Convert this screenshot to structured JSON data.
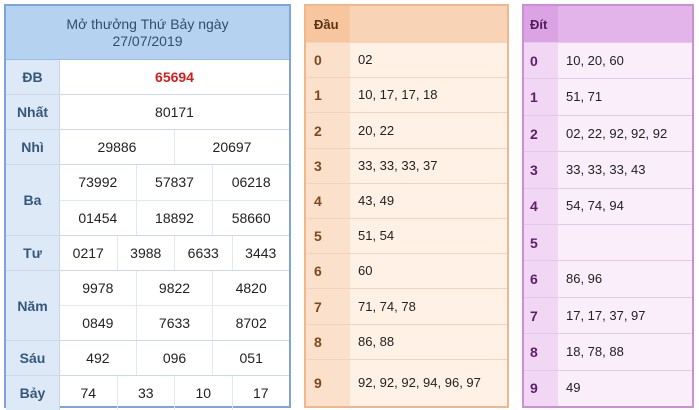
{
  "results": {
    "title_line1": "Mở thưởng Thứ Bảy ngày",
    "title_line2": "27/07/2019",
    "prizes": [
      {
        "label": "ĐB",
        "lines": [
          [
            "65694"
          ]
        ]
      },
      {
        "label": "Nhất",
        "lines": [
          [
            "80171"
          ]
        ]
      },
      {
        "label": "Nhì",
        "lines": [
          [
            "29886",
            "20697"
          ]
        ]
      },
      {
        "label": "Ba",
        "lines": [
          [
            "73992",
            "57837",
            "06218"
          ],
          [
            "01454",
            "18892",
            "58660"
          ]
        ]
      },
      {
        "label": "Tư",
        "lines": [
          [
            "0217",
            "3988",
            "6633",
            "3443"
          ]
        ]
      },
      {
        "label": "Năm",
        "lines": [
          [
            "9978",
            "9822",
            "4820"
          ],
          [
            "0849",
            "7633",
            "8702"
          ]
        ]
      },
      {
        "label": "Sáu",
        "lines": [
          [
            "492",
            "096",
            "051"
          ]
        ]
      },
      {
        "label": "Bảy",
        "lines": [
          [
            "74",
            "33",
            "10",
            "17"
          ]
        ]
      }
    ]
  },
  "dau": {
    "header": "Đầu",
    "rows": [
      {
        "k": "0",
        "v": "02"
      },
      {
        "k": "1",
        "v": "10, 17, 17, 18"
      },
      {
        "k": "2",
        "v": "20, 22"
      },
      {
        "k": "3",
        "v": "33, 33, 33, 37"
      },
      {
        "k": "4",
        "v": "43, 49"
      },
      {
        "k": "5",
        "v": "51, 54"
      },
      {
        "k": "6",
        "v": "60"
      },
      {
        "k": "7",
        "v": "71, 74, 78"
      },
      {
        "k": "8",
        "v": "86, 88"
      },
      {
        "k": "9",
        "v": "92, 92, 92, 94, 96, 97"
      }
    ]
  },
  "dit": {
    "header": "Đít",
    "rows": [
      {
        "k": "0",
        "v": "10, 20, 60"
      },
      {
        "k": "1",
        "v": "51, 71"
      },
      {
        "k": "2",
        "v": "02, 22, 92, 92, 92"
      },
      {
        "k": "3",
        "v": "33, 33, 33, 43"
      },
      {
        "k": "4",
        "v": "54, 74, 94"
      },
      {
        "k": "5",
        "v": ""
      },
      {
        "k": "6",
        "v": "86, 96"
      },
      {
        "k": "7",
        "v": "17, 17, 37, 97"
      },
      {
        "k": "8",
        "v": "18, 78, 88"
      },
      {
        "k": "9",
        "v": "49"
      }
    ]
  }
}
